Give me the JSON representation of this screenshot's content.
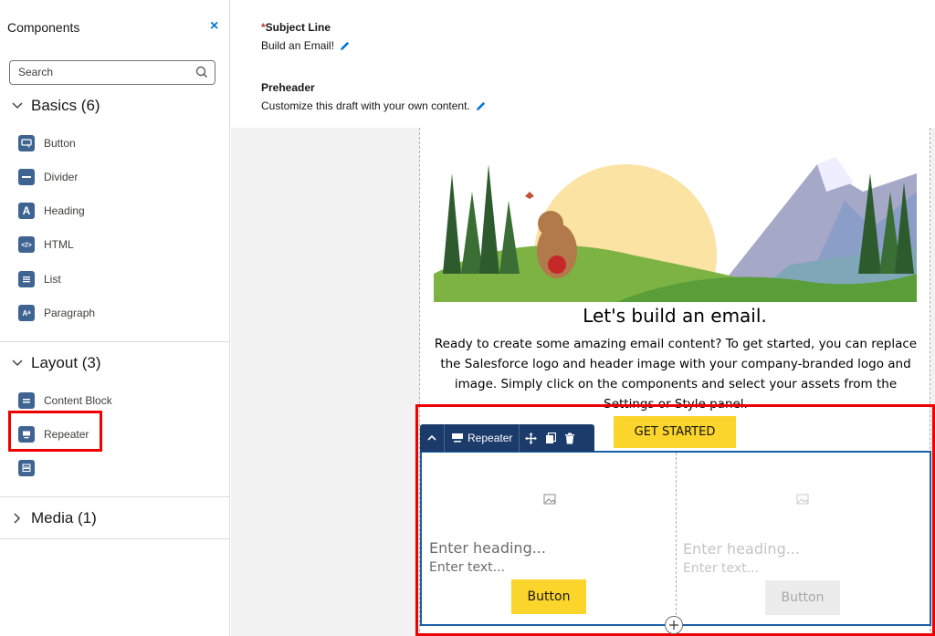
{
  "sidebar": {
    "title": "Components",
    "close": "×",
    "search_placeholder": "Search",
    "groups": [
      {
        "label": "Basics (6)",
        "items": [
          {
            "label": "Button",
            "icon": "button-icon"
          },
          {
            "label": "Divider",
            "icon": "divider-icon"
          },
          {
            "label": "Heading",
            "icon": "heading-icon"
          },
          {
            "label": "HTML",
            "icon": "html-icon"
          },
          {
            "label": "List",
            "icon": "list-icon"
          },
          {
            "label": "Paragraph",
            "icon": "paragraph-icon"
          }
        ]
      },
      {
        "label": "Layout (3)",
        "items": [
          {
            "label": "Content Block",
            "icon": "content-block-icon"
          },
          {
            "label": "Repeater",
            "icon": "repeater-icon"
          },
          {
            "label": "",
            "icon": "layout-icon"
          }
        ]
      },
      {
        "label": "Media (1)",
        "items": []
      }
    ]
  },
  "header": {
    "subject_label_req": "*",
    "subject_label": "Subject Line",
    "subject_value": "Build an Email!",
    "preheader_label": "Preheader",
    "preheader_value": "Customize this draft with your own content."
  },
  "email": {
    "title": "Let's build an email.",
    "body": "Ready to create some amazing email content? To get started, you can replace the Salesforce logo and header image with your company-branded logo and image. Simply click on the components and select your assets from the Settings or Style panel.",
    "cta": "GET STARTED"
  },
  "toolbar": {
    "label": "Repeater"
  },
  "repeater": {
    "columns": [
      {
        "heading": "Enter heading...",
        "text": "Enter text...",
        "button": "Button",
        "active": true
      },
      {
        "heading": "Enter heading...",
        "text": "Enter text...",
        "button": "Button",
        "active": false
      }
    ]
  },
  "colors": {
    "accent": "#0176d3",
    "highlight": "#e00000",
    "cta": "#fcd52c",
    "toolbar": "#1b3b6b"
  }
}
